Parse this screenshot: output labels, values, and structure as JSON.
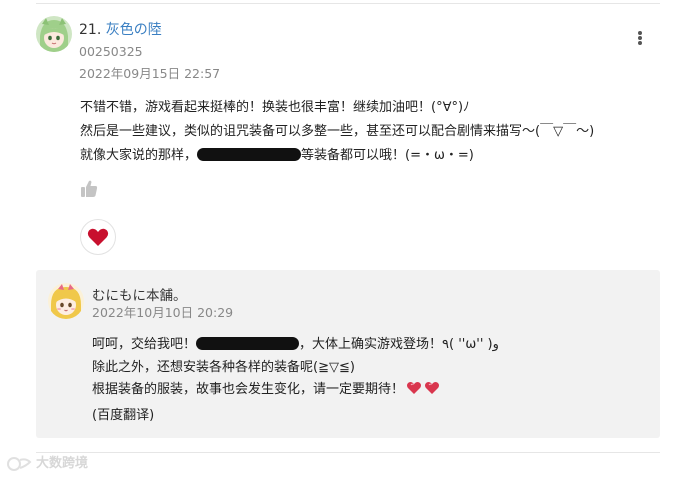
{
  "comment": {
    "floor_number": "21.",
    "author_name": "灰色の陸",
    "user_id": "00250325",
    "posted_at": "2022年09月15日  22:57",
    "body_lines": {
      "line1": "不错不错，游戏看起来挺棒的！换装也很丰富！继续加油吧！(°∀°)ﾉ",
      "line2": "然后是一些建议，类似的诅咒装备可以多整一些，甚至还可以配合剧情来描写～(￣▽￣～)",
      "line3_before": "就像大家说的那样，",
      "line3_after": "等装备都可以哦！(=・ω・=)"
    }
  },
  "reply": {
    "author_name": "むにもに本舗。",
    "posted_at": "2022年10月10日  20:29",
    "lines": {
      "line1_before": "呵呵，交给我吧！",
      "line1_after": "，大体上确实游戏登场！٩( ''ω'' )و",
      "line2": "除此之外，还想安装各种各样的装备呢(≧▽≦)",
      "line3": "根据装备的服装，故事也会发生变化，请一定要期待！",
      "line4": "(百度翻译)"
    }
  },
  "watermark": {
    "text": "大数跨境"
  },
  "colors": {
    "author_link": "#3a7fc2",
    "meta_text": "#888888",
    "reply_background": "#f2f2f2",
    "heart_red": "#c8102e"
  },
  "icons": {
    "more": "more-vertical-icon",
    "like": "thumbs-up-icon",
    "favorite": "heart-icon",
    "reply_emoji": "two-hearts-icon"
  }
}
